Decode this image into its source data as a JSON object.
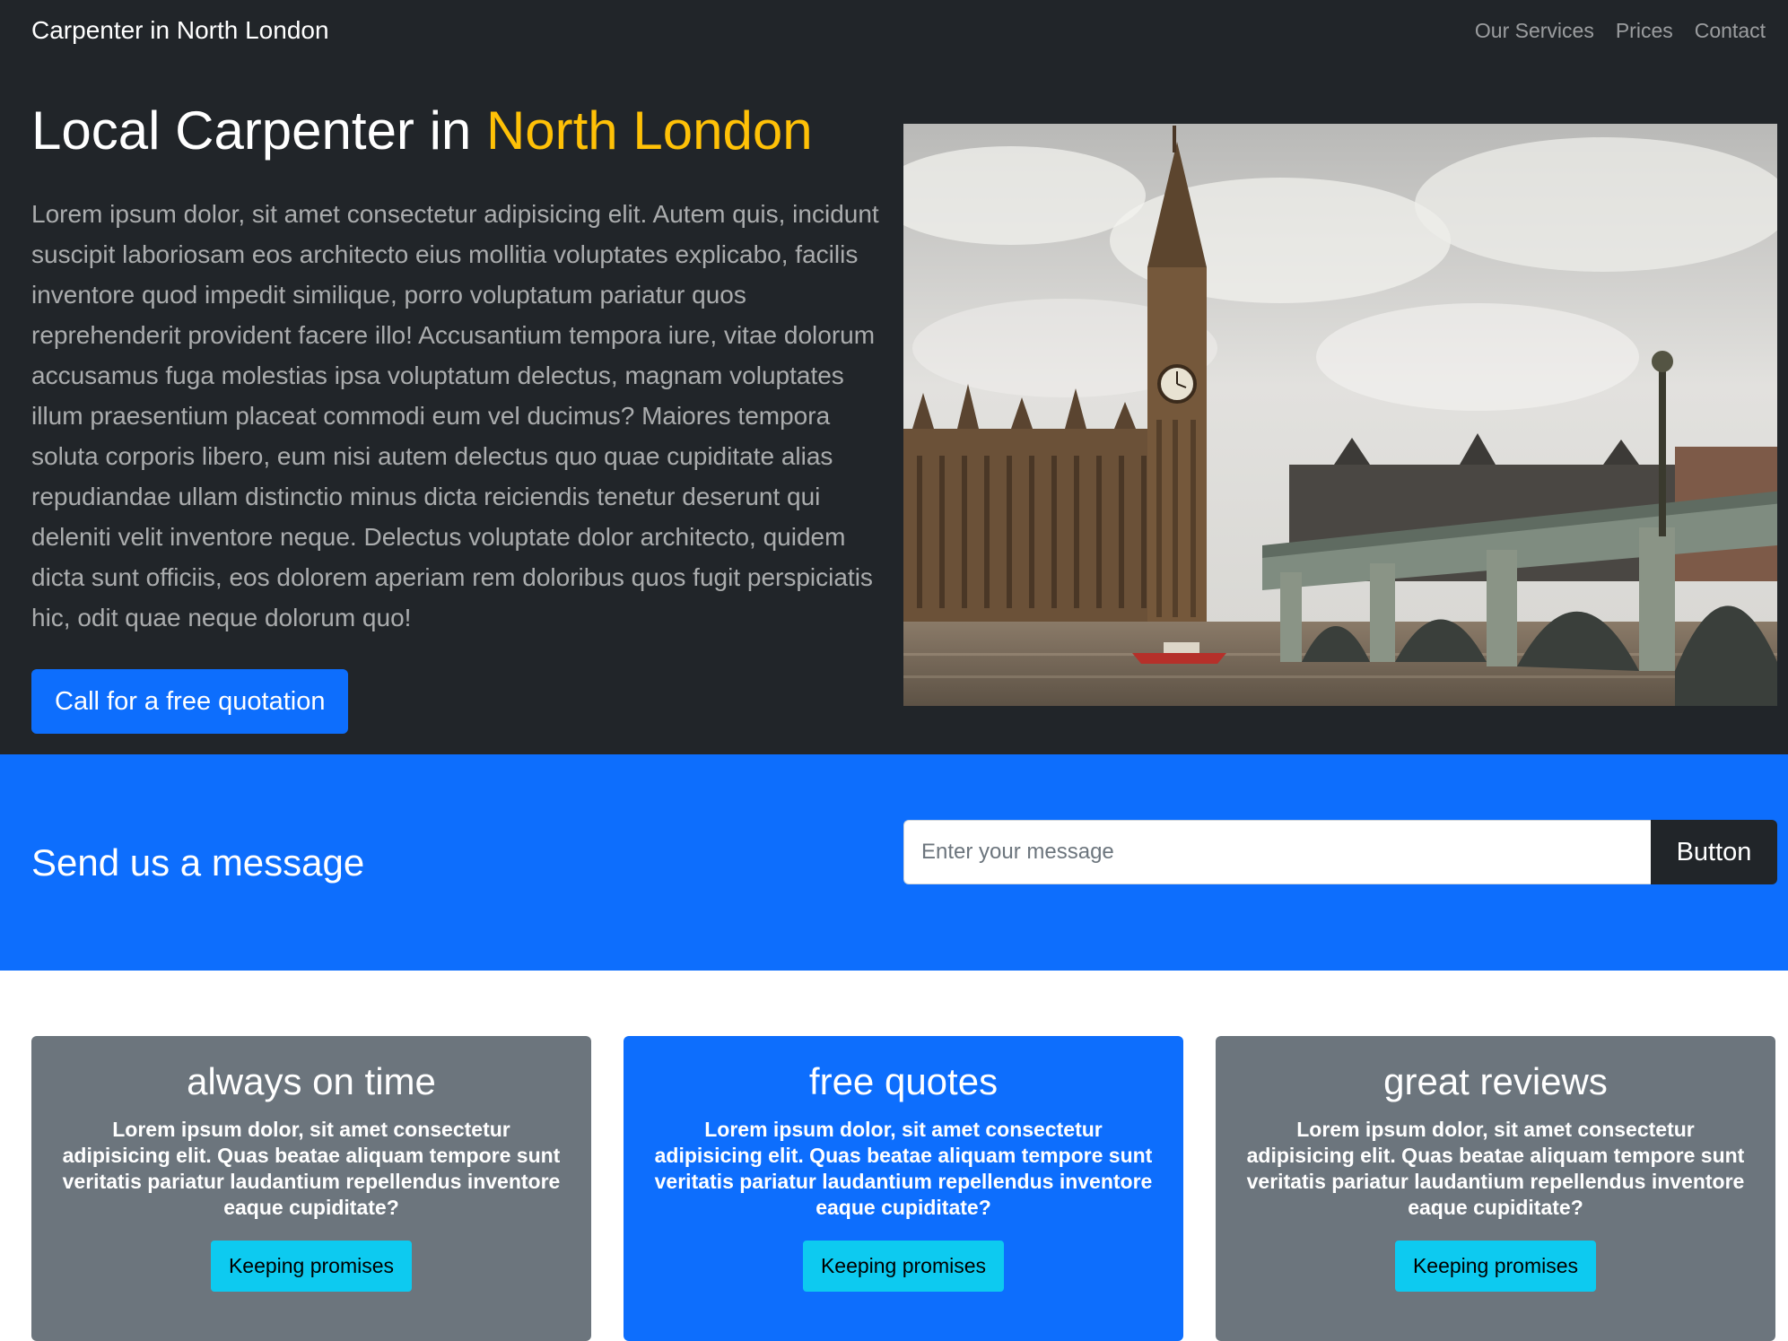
{
  "navbar": {
    "brand": "Carpenter in North London",
    "links": [
      "Our Services",
      "Prices",
      "Contact"
    ]
  },
  "hero": {
    "title_main": "Local Carpenter in ",
    "title_accent": "North London",
    "paragraph": "Lorem ipsum dolor, sit amet consectetur adipisicing elit. Autem quis, incidunt suscipit laboriosam eos architecto eius mollitia voluptates explicabo, facilis inventore quod impedit similique, porro voluptatum pariatur quos reprehenderit provident facere illo! Accusantium tempora iure, vitae dolorum accusamus fuga molestias ipsa voluptatum delectus, magnam voluptates illum praesentium placeat commodi eum vel ducimus? Maiores tempora soluta corporis libero, eum nisi autem delectus quo quae cupiditate alias repudiandae ullam distinctio minus dicta reiciendis tenetur deserunt qui deleniti velit inventore neque. Delectus voluptate dolor architecto, quidem dicta sunt officiis, eos dolorem aperiam rem doloribus quos fugit perspiciatis hic, odit quae neque dolorum quo!",
    "cta_label": "Call for a free quotation",
    "image_icon": "big-ben-westminster-photo"
  },
  "message": {
    "heading": "Send us a message",
    "placeholder": "Enter your message",
    "button_label": "Button"
  },
  "cards": [
    {
      "title": "always on time",
      "text": "Lorem ipsum dolor, sit amet consectetur adipisicing elit. Quas beatae aliquam tempore sunt veritatis pariatur laudantium repellendus inventore eaque cupiditate?",
      "button_label": "Keeping promises"
    },
    {
      "title": "free quotes",
      "text": "Lorem ipsum dolor, sit amet consectetur adipisicing elit. Quas beatae aliquam tempore sunt veritatis pariatur laudantium repellendus inventore eaque cupiditate?",
      "button_label": "Keeping promises"
    },
    {
      "title": "great reviews",
      "text": "Lorem ipsum dolor, sit amet consectetur adipisicing elit. Quas beatae aliquam tempore sunt veritatis pariatur laudantium repellendus inventore eaque cupiditate?",
      "button_label": "Keeping promises"
    }
  ],
  "colors": {
    "dark_bg": "#212529",
    "accent_yellow": "#ffc107",
    "primary_blue": "#0d6efd",
    "card_grey": "#6c757d",
    "info_cyan": "#0dcaf0"
  }
}
